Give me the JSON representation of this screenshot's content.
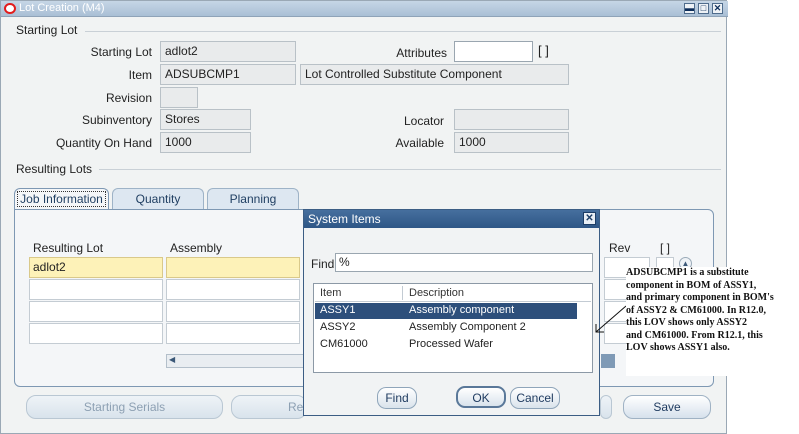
{
  "window": {
    "title": "Lot Creation (M4)"
  },
  "starting_lot": {
    "section_title": "Starting Lot",
    "starting_lot_label": "Starting Lot",
    "starting_lot_value": "adlot2",
    "item_label": "Item",
    "item_value": "ADSUBCMP1",
    "item_description": "Lot Controlled Substitute Component",
    "revision_label": "Revision",
    "revision_value": "",
    "subinventory_label": "Subinventory",
    "subinventory_value": "Stores",
    "qty_on_hand_label": "Quantity On Hand",
    "qty_on_hand_value": "1000",
    "attributes_label": "Attributes",
    "attributes_flex": "[ ]",
    "locator_label": "Locator",
    "locator_value": "",
    "available_label": "Available",
    "available_value": "1000"
  },
  "resulting_lots": {
    "section_title": "Resulting Lots",
    "tabs": [
      {
        "label": "Job Information",
        "active": true
      },
      {
        "label": "Quantity",
        "active": false
      },
      {
        "label": "Planning",
        "active": false
      }
    ],
    "columns": {
      "resulting_lot": "Resulting Lot",
      "assembly": "Assembly",
      "rev": "Rev",
      "flex": "[ ]"
    },
    "rows": [
      {
        "resulting_lot": "adlot2",
        "assembly": ""
      },
      {
        "resulting_lot": "",
        "assembly": ""
      },
      {
        "resulting_lot": "",
        "assembly": ""
      },
      {
        "resulting_lot": "",
        "assembly": ""
      }
    ]
  },
  "buttons": {
    "starting_serials": "Starting Serials",
    "resulting_partial": "Res",
    "save": "Save"
  },
  "dialog": {
    "title": "System Items",
    "find_label": "Find",
    "find_value": "%",
    "col_item": "Item",
    "col_description": "Description",
    "rows": [
      {
        "item": "ASSY1",
        "description": "Assembly component",
        "selected": true
      },
      {
        "item": "ASSY2",
        "description": "Assembly Component 2",
        "selected": false
      },
      {
        "item": "CM61000",
        "description": "Processed Wafer",
        "selected": false
      }
    ],
    "find_button": "Find",
    "ok_button": "OK",
    "cancel_button": "Cancel"
  },
  "callout": {
    "lines": [
      "ADSUBCMP1 is a substitute",
      "component in BOM of ASSY1,",
      "and primary component  in BOM's",
      "of ASSY2 & CM61000. In R12.0,",
      "this LOV shows only ASSY2",
      "and CM61000. From R12.1, this",
      "LOV shows ASSY1 also."
    ]
  },
  "colors": {
    "selection": "#2d4f7b",
    "current_record": "#fdf2b8",
    "title_bar": "#2e5686"
  }
}
